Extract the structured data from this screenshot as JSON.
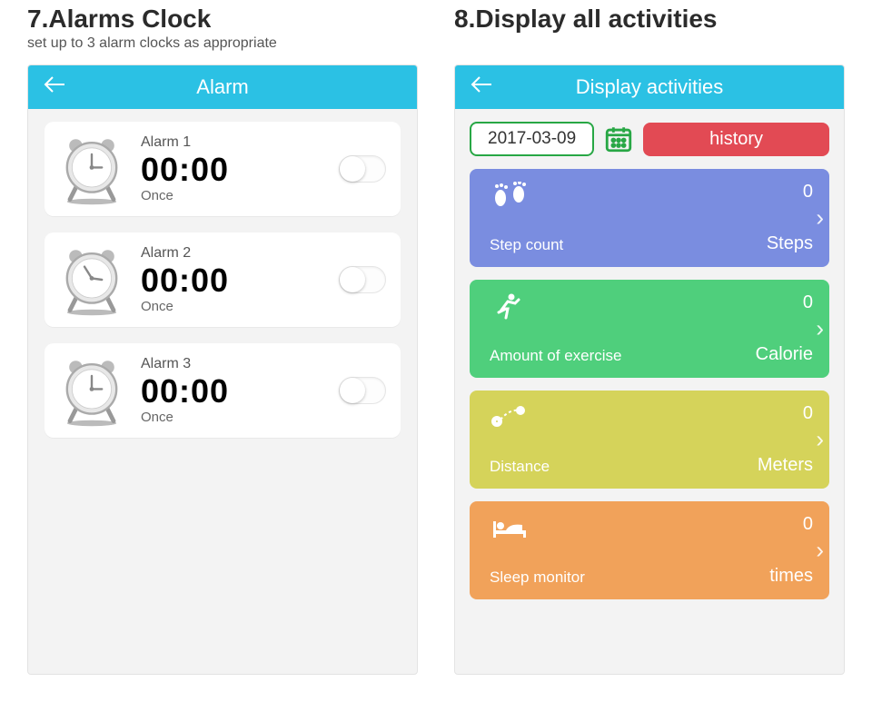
{
  "left": {
    "title": "7.Alarms Clock",
    "subtitle": "set up to 3 alarm clocks as appropriate",
    "appbar": "Alarm",
    "alarms": [
      {
        "name": "Alarm 1",
        "time": "00:00",
        "freq": "Once"
      },
      {
        "name": "Alarm 2",
        "time": "00:00",
        "freq": "Once"
      },
      {
        "name": "Alarm 3",
        "time": "00:00",
        "freq": "Once"
      }
    ]
  },
  "right": {
    "title": "8.Display all activities",
    "appbar": "Display activities",
    "date": "2017-03-09",
    "history": "history",
    "cards": [
      {
        "label": "Step count",
        "value": "0",
        "unit": "Steps"
      },
      {
        "label": "Amount of exercise",
        "value": "0",
        "unit": "Calorie"
      },
      {
        "label": "Distance",
        "value": "0",
        "unit": "Meters"
      },
      {
        "label": "Sleep monitor",
        "value": "0",
        "unit": "times"
      }
    ]
  }
}
